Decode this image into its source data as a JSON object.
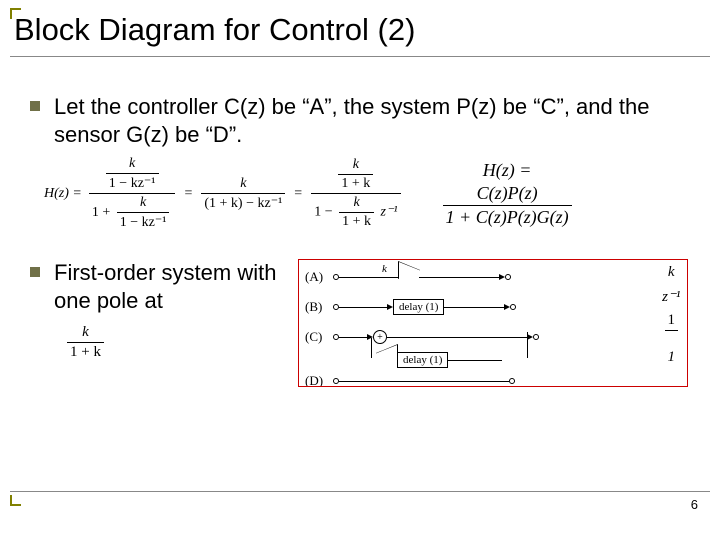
{
  "title": "Block Diagram for Control (2)",
  "bullets": {
    "b1": "Let the controller C(z) be “A”, the system P(z) be “C”, and the sensor G(z) be “D”.",
    "b2": "First-order system with one pole at"
  },
  "eq": {
    "Hz": "H(z) =",
    "num1": "k",
    "den1a": "1 − kz⁻¹",
    "one": "1 +",
    "mid_num": "k",
    "mid_den": "(1 + k) − kz⁻¹",
    "r_num": "k",
    "r_den_top": "1 + k",
    "r_den_bot_a": "1 −",
    "r_den_bot_num": "k",
    "r_den_bot_den": "1 + k",
    "r_den_bot_c": "z⁻¹",
    "side_lhs": "H(z) =",
    "side_num": "C(z)P(z)",
    "side_den": "1 + C(z)P(z)G(z)"
  },
  "pole": {
    "num": "k",
    "den": "1 + k"
  },
  "diagram": {
    "A": "(A)",
    "B": "(B)",
    "C": "(C)",
    "D": "(D)",
    "k": "k",
    "delay": "delay (1)",
    "tfA": "k",
    "tfB": "z⁻¹",
    "tfC_num": "1",
    "tfD_num": "1"
  },
  "page": "6"
}
